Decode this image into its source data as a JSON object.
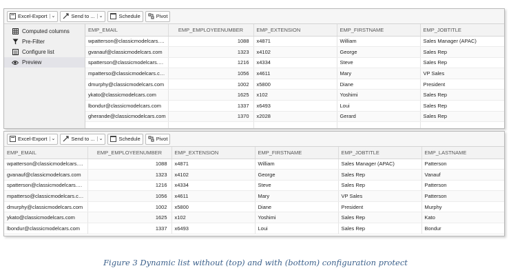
{
  "top_panel": {
    "toolbar": {
      "excel_export": "Excel-Export",
      "send_to": "Send to ...",
      "schedule": "Schedule",
      "pivot": "Pivot"
    },
    "sidebar": [
      {
        "label": "Computed columns",
        "icon": "table-icon"
      },
      {
        "label": "Pre-Filter",
        "icon": "filter-icon"
      },
      {
        "label": "Configure list",
        "icon": "list-icon"
      },
      {
        "label": "Preview",
        "icon": "eye-icon"
      }
    ],
    "columns": [
      "EMP_EMAIL",
      "EMP_EMPLOYEENUMBER",
      "EMP_EXTENSION",
      "EMP_FIRSTNAME",
      "EMP_JOBTITLE"
    ],
    "rows": [
      [
        "wpatterson@classicmodelcars.…",
        "1088",
        "x4871",
        "William",
        "Sales Manager (APAC)"
      ],
      [
        "gvanauf@classicmodelcars.com",
        "1323",
        "x4102",
        "George",
        "Sales Rep"
      ],
      [
        "spatterson@classicmodelcars.…",
        "1216",
        "x4334",
        "Steve",
        "Sales Rep"
      ],
      [
        "mpatterso@classicmodelcars.c…",
        "1056",
        "x4611",
        "Mary",
        "VP Sales"
      ],
      [
        "dmurphy@classicmodelcars.com",
        "1002",
        "x5800",
        "Diane",
        "President"
      ],
      [
        "ykato@classicmodelcars.com",
        "1625",
        "x102",
        "Yoshimi",
        "Sales Rep"
      ],
      [
        "lbondur@classicmodelcars.com",
        "1337",
        "x6493",
        "Loui",
        "Sales Rep"
      ],
      [
        "gherande@classicmodelcars.com",
        "1370",
        "x2028",
        "Gerard",
        "Sales Rep"
      ],
      [
        "",
        "",
        "",
        "",
        ""
      ]
    ]
  },
  "bottom_panel": {
    "toolbar": {
      "excel_export": "Excel-Export",
      "send_to": "Send to ...",
      "schedule": "Schedule",
      "pivot": "Pivot"
    },
    "columns": [
      "EMP_EMAIL",
      "EMP_EMPLOYEENUMBER",
      "EMP_EXTENSION",
      "EMP_FIRSTNAME",
      "EMP_JOBTITLE",
      "EMP_LASTNAME"
    ],
    "rows": [
      [
        "wpatterson@classicmodelcars.…",
        "1088",
        "x4871",
        "William",
        "Sales Manager (APAC)",
        "Patterson"
      ],
      [
        "gvanauf@classicmodelcars.com",
        "1323",
        "x4102",
        "George",
        "Sales Rep",
        "Vanauf"
      ],
      [
        "spatterson@classicmodelcars.…",
        "1216",
        "x4334",
        "Steve",
        "Sales Rep",
        "Patterson"
      ],
      [
        "mpatterso@classicmodelcars.c…",
        "1056",
        "x4611",
        "Mary",
        "VP Sales",
        "Patterson"
      ],
      [
        "dmurphy@classicmodelcars.com",
        "1002",
        "x5800",
        "Diane",
        "President",
        "Murphy"
      ],
      [
        "ykato@classicmodelcars.com",
        "1625",
        "x102",
        "Yoshimi",
        "Sales Rep",
        "Kato"
      ],
      [
        "lbondur@classicmodelcars.com",
        "1337",
        "x6493",
        "Loui",
        "Sales Rep",
        "Bondur"
      ]
    ]
  },
  "caption": "Figure 3 Dynamic list without (top) and with (bottom) configuration protect"
}
